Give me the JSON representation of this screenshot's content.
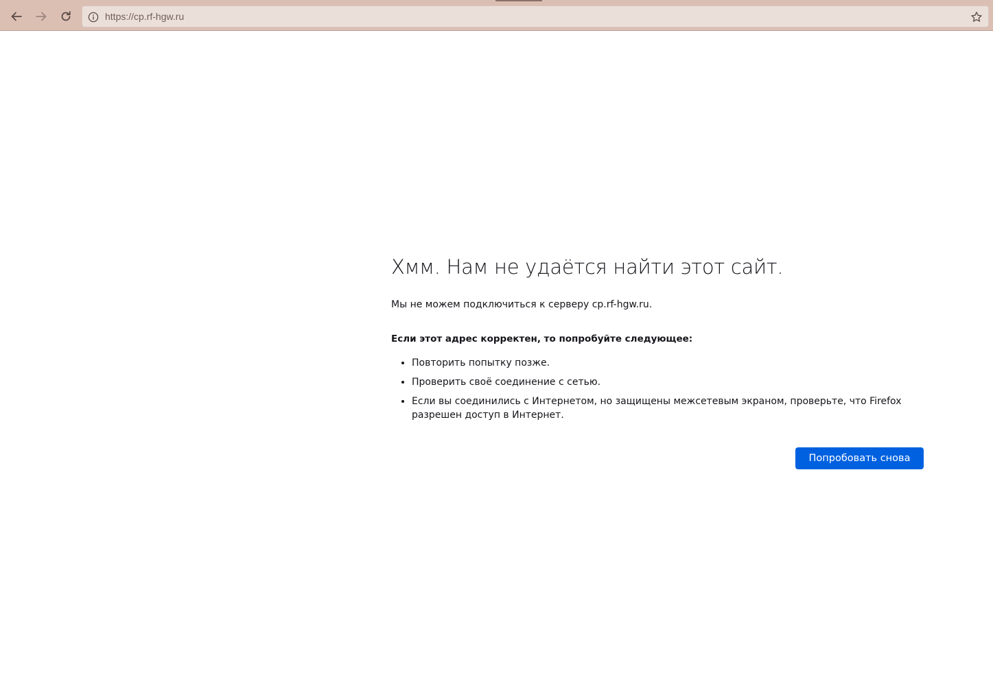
{
  "toolbar": {
    "back_icon": "arrow-left-icon",
    "forward_icon": "arrow-right-icon",
    "reload_icon": "reload-icon",
    "info_icon": "info-circle-icon",
    "bookmark_icon": "star-icon",
    "url": "https://cp.rf-hgw.ru"
  },
  "error": {
    "title": "Хмм. Нам не удаётся найти этот сайт.",
    "description": "Мы не можем подключиться к серверу cp.rf-hgw.ru.",
    "suggest_heading": "Если этот адрес корректен, то попробуйте следующее:",
    "suggestions": [
      "Повторить попытку позже.",
      "Проверить своё соединение с сетью.",
      "Если вы соединились с Интернетом, но защищены межсетевым экраном, проверьте, что Firefox разрешен доступ в Интернет."
    ],
    "retry_label": "Попробовать снова"
  },
  "colors": {
    "toolbar_bg": "#dcbfb3",
    "urlbar_bg": "#ebdfd9",
    "primary_button": "#0061e0"
  }
}
